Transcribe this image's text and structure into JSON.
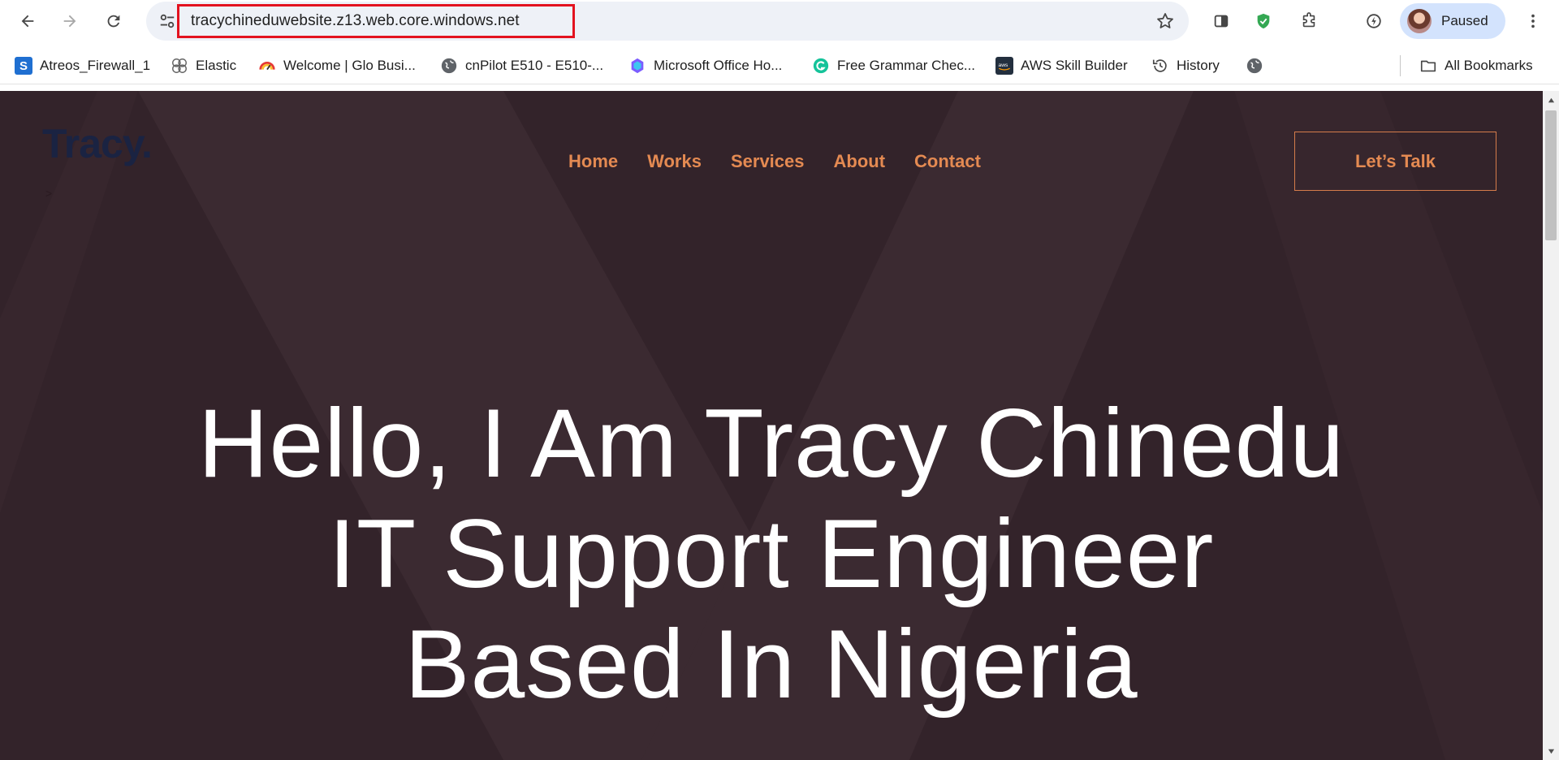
{
  "browser": {
    "url": "tracychineduwebsite.z13.web.core.windows.net",
    "profile_label": "Paused",
    "bookmarks": [
      {
        "label": "Atreos_Firewall_1",
        "icon": "s-logo-icon"
      },
      {
        "label": "Elastic",
        "icon": "elastic-icon"
      },
      {
        "label": "Welcome | Glo Busi...",
        "icon": "glo-gauge-icon"
      },
      {
        "label": "cnPilot E510 - E510-...",
        "icon": "globe-icon"
      },
      {
        "label": "Microsoft Office Ho...",
        "icon": "microsoft-office-icon"
      },
      {
        "label": "Free Grammar Chec...",
        "icon": "grammarly-icon"
      },
      {
        "label": "AWS Skill Builder",
        "icon": "aws-icon"
      },
      {
        "label": "History",
        "icon": "history-icon"
      },
      {
        "label": "",
        "icon": "globe-icon"
      }
    ],
    "all_bookmarks_label": "All Bookmarks"
  },
  "site": {
    "logo": "Tracy.",
    "logo_caret": ">",
    "nav": [
      "Home",
      "Works",
      "Services",
      "About",
      "Contact"
    ],
    "cta": "Let’s Talk",
    "hero_lines": [
      "Hello, I Am Tracy Chinedu",
      "IT Support Engineer",
      "Based In Nigeria"
    ]
  },
  "colors": {
    "page_bg": "#33232a",
    "accent": "#e48a52",
    "url_highlight": "#e3121f",
    "logo": "#1a2342"
  }
}
